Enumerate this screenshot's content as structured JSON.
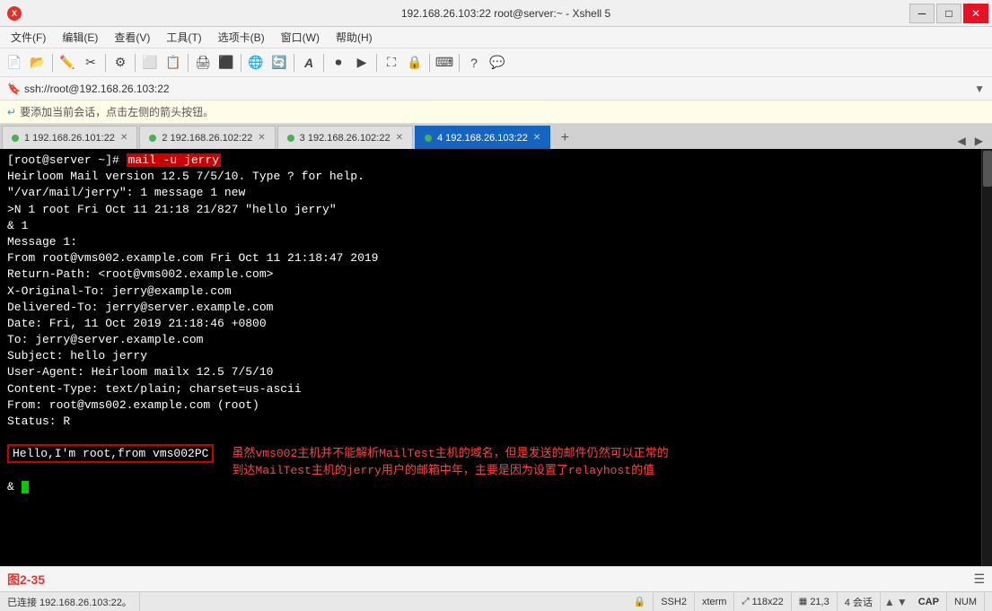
{
  "titlebar": {
    "title": "192.168.26.103:22    root@server:~ - Xshell 5",
    "icon_color": "#e03030"
  },
  "menubar": {
    "items": [
      {
        "label": "文件(F)"
      },
      {
        "label": "编辑(E)"
      },
      {
        "label": "查看(V)"
      },
      {
        "label": "工具(T)"
      },
      {
        "label": "选项卡(B)"
      },
      {
        "label": "窗口(W)"
      },
      {
        "label": "帮助(H)"
      }
    ]
  },
  "address_bar": {
    "prefix": "ssh://root@192.168.26.103:22"
  },
  "info_bar": {
    "text": "要添加当前会话，点击左侧的箭头按钮。"
  },
  "tabs": [
    {
      "id": 1,
      "label": "1 192.168.26.101:22",
      "active": false
    },
    {
      "id": 2,
      "label": "2 192.168.26.102:22",
      "active": false
    },
    {
      "id": 3,
      "label": "3 192.168.26.102:22",
      "active": false
    },
    {
      "id": 4,
      "label": "4 192.168.26.103:22",
      "active": true
    }
  ],
  "terminal": {
    "prompt": "[root@server ~]#",
    "command": " mail -u jerry",
    "lines": [
      "Heirloom Mail version 12.5 7/5/10.  Type ? for help.",
      "\"/var/mail/jerry\": 1 message 1 new",
      ">N  1 root                  Fri Oct 11 21:18  21/827   \"hello jerry\"",
      "& 1",
      "Message  1:",
      "From root@vms002.example.com  Fri Oct 11 21:18:47 2019",
      "Return-Path: <root@vms002.example.com>",
      "X-Original-To: jerry@example.com",
      "Delivered-To: jerry@server.example.com",
      "Date: Fri, 11 Oct 2019 21:18:46 +0800",
      "To: jerry@server.example.com",
      "Subject: hello jerry",
      "User-Agent: Heirloom mailx 12.5 7/5/10",
      "Content-Type: text/plain; charset=us-ascii",
      "From: root@vms002.example.com (root)",
      "Status: R",
      "",
      "Hello,I'm root,from vms002PC",
      ""
    ],
    "annotation_text1": "虽然vms002主机并不能解析MailTest主机的域名，但是发送的邮件仍然可以正常的",
    "annotation_text2": "到达MailTest主机的jerry用户的邮箱中年，主要是因为设置了relayhost的值",
    "prompt2": "&",
    "cursor": true
  },
  "caption": {
    "text": "图2-35"
  },
  "statusbar": {
    "connection": "已连接 192.168.26.103:22。",
    "ssh": "SSH2",
    "terminal": "xterm",
    "size": "118x22",
    "position": "21,3",
    "sessions": "4 会话",
    "caps": "CAP",
    "num": "NUM"
  }
}
